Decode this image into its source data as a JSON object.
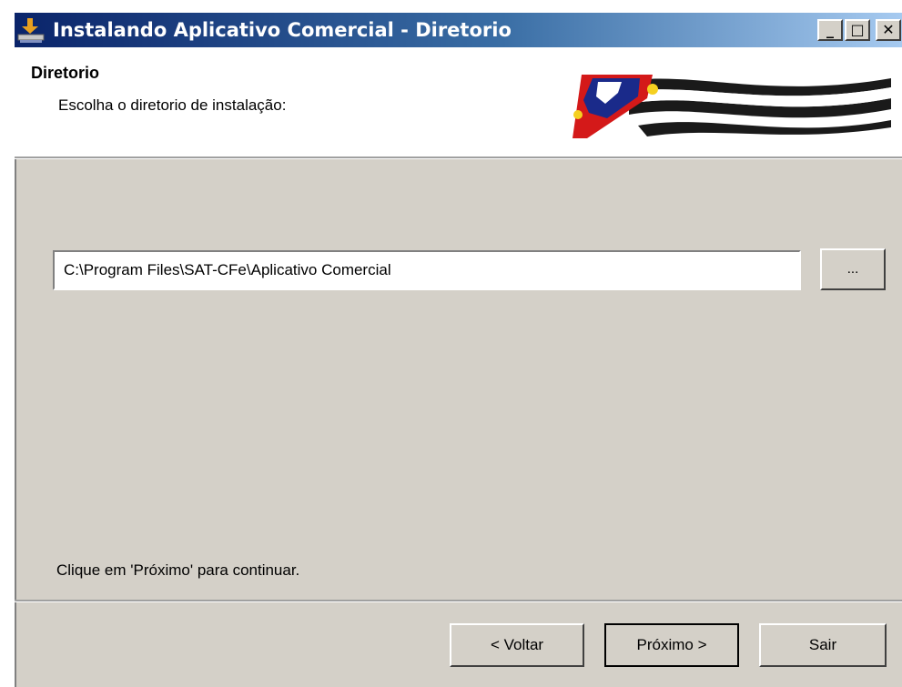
{
  "window": {
    "title": "Instalando Aplicativo Comercial  - Diretorio",
    "minimize_glyph": "_",
    "maximize_glyph": "□",
    "close_glyph": "✕",
    "icon": "installer-icon"
  },
  "header": {
    "title": "Diretorio",
    "subtitle": "Escolha o diretorio de instalação:",
    "logo": "sao-paulo-flag-logo"
  },
  "main": {
    "path_value": "C:\\Program Files\\SAT-CFe\\Aplicativo Comercial",
    "browse_label": "...",
    "hint": "Clique em 'Próximo' para continuar."
  },
  "footer": {
    "back_label": "< Voltar",
    "next_label": "Próximo >",
    "exit_label": "Sair"
  },
  "colors": {
    "title_gradient_start": "#0a246a",
    "title_gradient_end": "#a6caf0",
    "dialog_bg": "#d4d0c8"
  }
}
